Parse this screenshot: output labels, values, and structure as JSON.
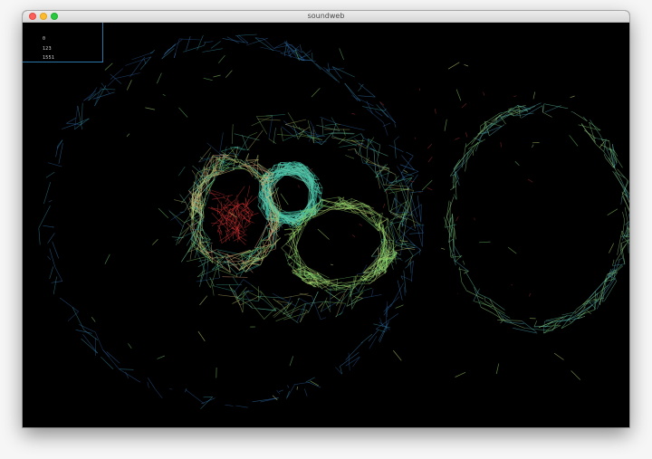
{
  "window": {
    "title": "soundweb"
  },
  "hud": {
    "lines": [
      "0",
      "123",
      "1551"
    ]
  },
  "colors": {
    "background": "#000000",
    "ring_blue": "#2f6fb2",
    "ring_teal": "#3fb6a2",
    "ring_green": "#8ed46a",
    "hot_red": "#ff3b3b",
    "hud_border": "#2a76a8"
  },
  "icons": {
    "close": "close-dot-icon",
    "minimize": "minimize-dot-icon",
    "maximize": "maximize-dot-icon"
  }
}
